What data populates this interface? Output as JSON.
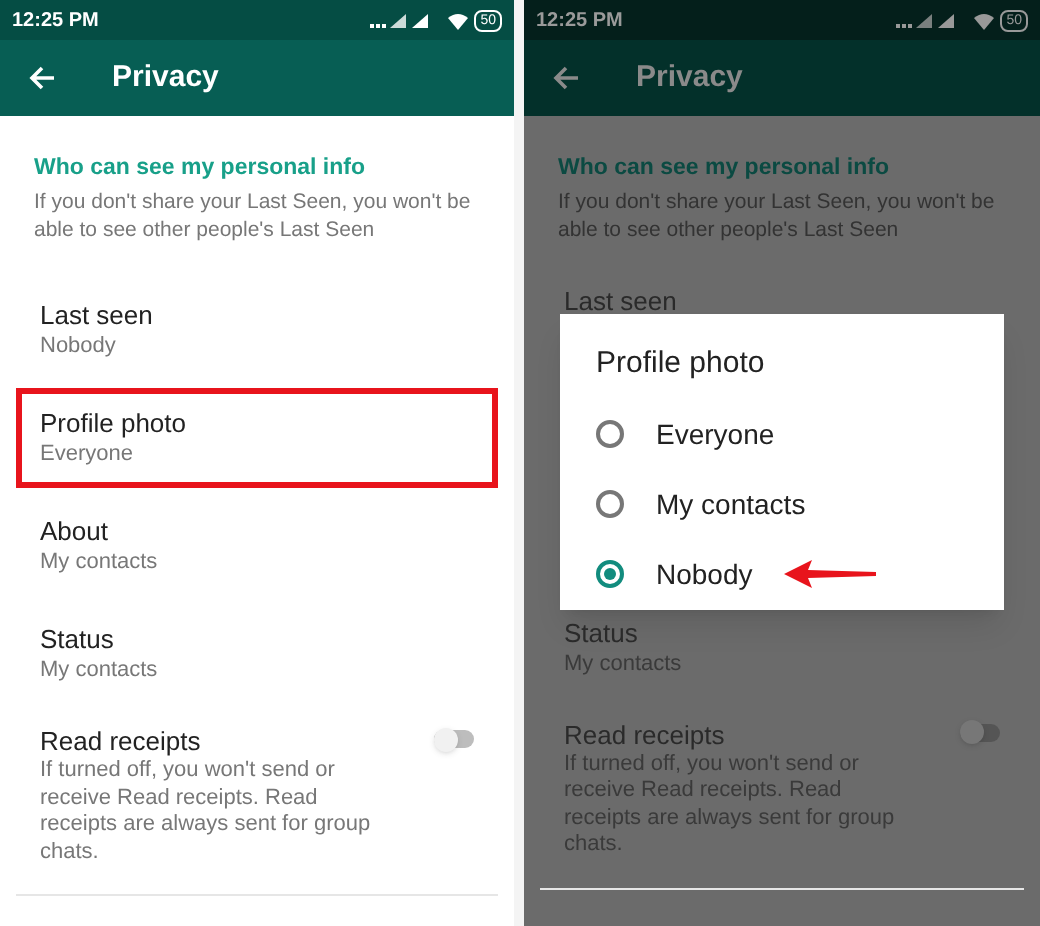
{
  "left_screen": {
    "status_bar": {
      "time": "12:25 PM",
      "battery": "50"
    },
    "app_bar": {
      "title": "Privacy"
    },
    "section_title": "Who can see my personal info",
    "section_description": "If you don't share your Last Seen, you won't be able to see other people's Last Seen",
    "settings": [
      {
        "kind": "option",
        "label": "Last seen",
        "value": "Nobody",
        "highlighted": false
      },
      {
        "kind": "option",
        "label": "Profile photo",
        "value": "Everyone",
        "highlighted": true
      },
      {
        "kind": "option",
        "label": "About",
        "value": "My contacts",
        "highlighted": false
      },
      {
        "kind": "option",
        "label": "Status",
        "value": "My contacts",
        "highlighted": false
      },
      {
        "kind": "toggle",
        "label": "Read receipts",
        "description": "If turned off, you won't send or receive Read receipts. Read receipts are always sent for group chats.",
        "on": false
      }
    ]
  },
  "right_screen": {
    "status_bar": {
      "time": "12:25 PM",
      "battery": "50"
    },
    "app_bar": {
      "title": "Privacy"
    },
    "section_title": "Who can see my personal info",
    "section_description": "If you don't share your Last Seen, you won't be able to see other people's Last Seen",
    "settings_above": [
      {
        "label": "Last seen"
      }
    ],
    "dialog": {
      "title": "Profile photo",
      "options": [
        {
          "label": "Everyone",
          "selected": false,
          "arrow": false
        },
        {
          "label": "My contacts",
          "selected": false,
          "arrow": false
        },
        {
          "label": "Nobody",
          "selected": true,
          "arrow": true
        }
      ]
    },
    "settings_below": [
      {
        "kind": "option",
        "label": "Status",
        "value": "My contacts"
      },
      {
        "kind": "toggle",
        "label": "Read receipts",
        "description": "If turned off, you won't send or receive Read receipts. Read receipts are always sent for group chats.",
        "on": false
      }
    ]
  }
}
